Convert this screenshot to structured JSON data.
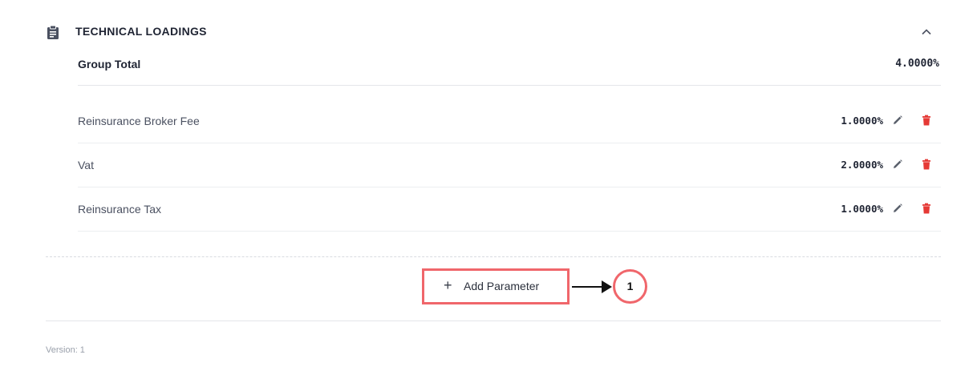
{
  "section": {
    "title": "TECHNICAL LOADINGS",
    "icon": "clipboard-icon",
    "collapse_icon": "chevron-up-icon"
  },
  "group_total": {
    "label": "Group Total",
    "value": "4.0000%"
  },
  "parameters": [
    {
      "label": "Reinsurance Broker Fee",
      "value": "1.0000%"
    },
    {
      "label": "Vat",
      "value": "2.0000%"
    },
    {
      "label": "Reinsurance Tax",
      "value": "1.0000%"
    }
  ],
  "actions": {
    "edit_icon": "pencil-icon",
    "delete_icon": "trash-icon"
  },
  "add_parameter": {
    "plus": "+",
    "label": "Add Parameter"
  },
  "callout": {
    "number": "1"
  },
  "footer": {
    "version": "Version: 1"
  },
  "colors": {
    "delete_red": "#e53935",
    "highlight_red": "#f0666b",
    "title_dark": "#1f2433"
  }
}
